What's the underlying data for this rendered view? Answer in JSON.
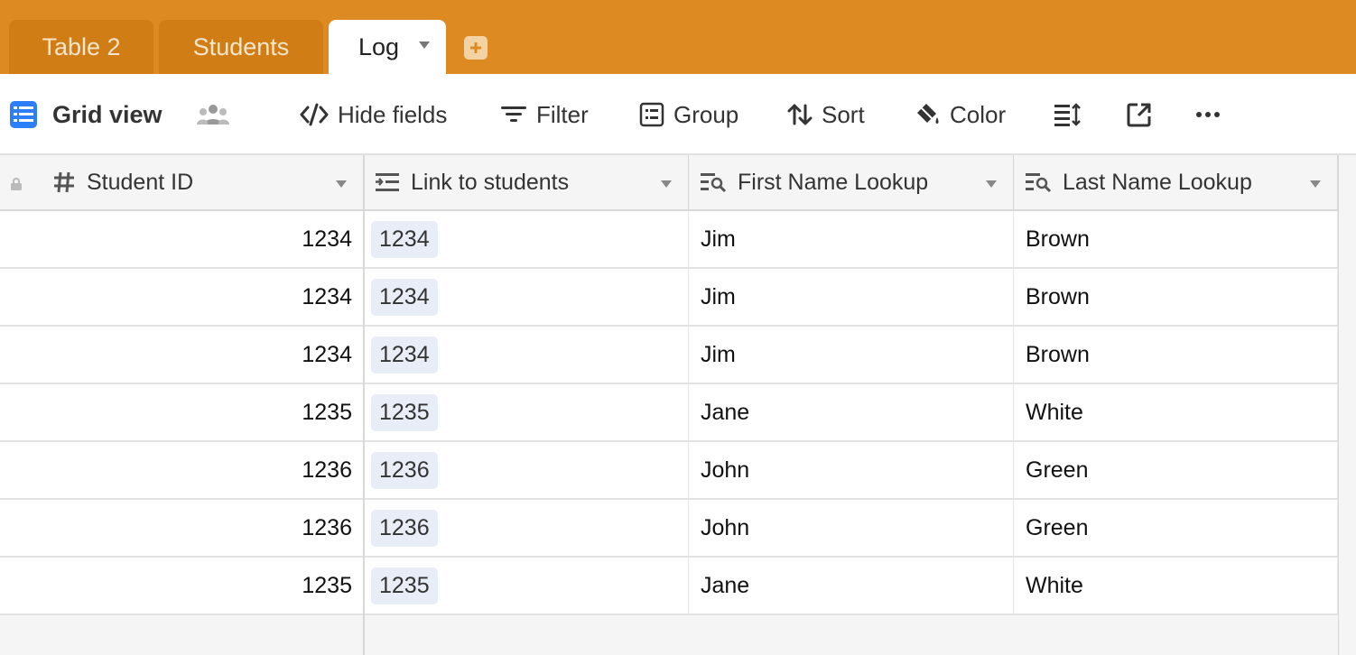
{
  "tabs": [
    {
      "label": "Table 2",
      "active": false
    },
    {
      "label": "Students",
      "active": false
    },
    {
      "label": "Log",
      "active": true
    }
  ],
  "colors": {
    "tabbar": "#de8a22",
    "view_icon": "#2d7ff9"
  },
  "toolbar": {
    "view_name": "Grid view",
    "hide_fields": "Hide fields",
    "filter": "Filter",
    "group": "Group",
    "sort": "Sort",
    "color": "Color"
  },
  "columns": [
    {
      "name": "Student ID",
      "icon": "hash-icon"
    },
    {
      "name": "Link to students",
      "icon": "link-records-icon"
    },
    {
      "name": "First Name Lookup",
      "icon": "lookup-icon"
    },
    {
      "name": "Last Name Lookup",
      "icon": "lookup-icon"
    }
  ],
  "rows": [
    {
      "student_id": "1234",
      "link": "1234",
      "first": "Jim",
      "last": "Brown"
    },
    {
      "student_id": "1234",
      "link": "1234",
      "first": "Jim",
      "last": "Brown"
    },
    {
      "student_id": "1234",
      "link": "1234",
      "first": "Jim",
      "last": "Brown"
    },
    {
      "student_id": "1235",
      "link": "1235",
      "first": "Jane",
      "last": "White"
    },
    {
      "student_id": "1236",
      "link": "1236",
      "first": "John",
      "last": "Green"
    },
    {
      "student_id": "1236",
      "link": "1236",
      "first": "John",
      "last": "Green"
    },
    {
      "student_id": "1235",
      "link": "1235",
      "first": "Jane",
      "last": "White"
    }
  ]
}
